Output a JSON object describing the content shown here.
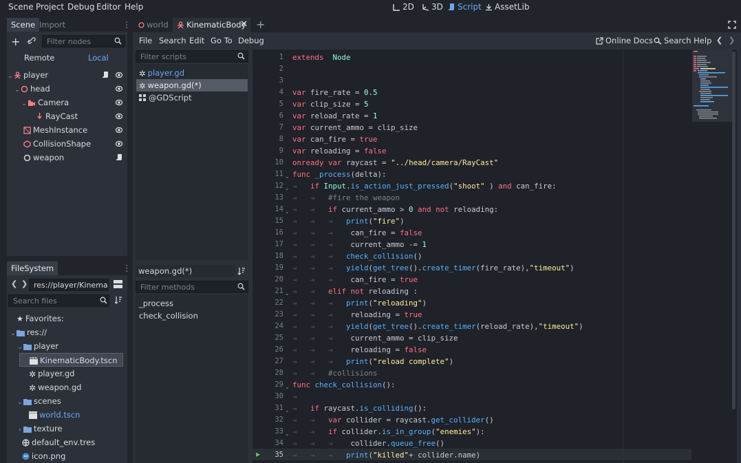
{
  "menu": [
    "Scene",
    "Project",
    "Debug",
    "Editor",
    "Help"
  ],
  "workspaces": [
    {
      "label": "2D",
      "icon": "2d-icon",
      "active": false
    },
    {
      "label": "3D",
      "icon": "3d-icon",
      "active": false
    },
    {
      "label": "Script",
      "icon": "script-icon",
      "active": true
    },
    {
      "label": "AssetLib",
      "icon": "assetlib-icon",
      "active": false
    }
  ],
  "scene_dock": {
    "tabs": [
      "Scene",
      "Import"
    ],
    "filter_placeholder": "Filter nodes",
    "remote": "Remote",
    "local": "Local",
    "nodes": [
      {
        "label": "player",
        "icon": "kinematic-body-icon"
      },
      {
        "label": "head",
        "icon": "spatial-icon"
      },
      {
        "label": "Camera",
        "icon": "camera-icon"
      },
      {
        "label": "RayCast",
        "icon": "raycast-icon"
      },
      {
        "label": "MeshInstance",
        "icon": "mesh-instance-icon"
      },
      {
        "label": "CollisionShape",
        "icon": "collision-shape-icon"
      },
      {
        "label": "weapon",
        "icon": "spatial-icon"
      }
    ]
  },
  "filesystem": {
    "tab": "FileSystem",
    "path": "res://player/Kinematic",
    "search_placeholder": "Search files",
    "items": [
      {
        "label": "Favorites:"
      },
      {
        "label": "res://"
      },
      {
        "label": "player"
      },
      {
        "label": "KinematicBody.tscn"
      },
      {
        "label": "player.gd"
      },
      {
        "label": "weapon.gd"
      },
      {
        "label": "scenes"
      },
      {
        "label": "world.tscn"
      },
      {
        "label": "texture"
      },
      {
        "label": "default_env.tres"
      },
      {
        "label": "icon.png"
      }
    ]
  },
  "scene_tabs": [
    {
      "label": "world",
      "active": false
    },
    {
      "label": "KinematicBody",
      "active": true
    }
  ],
  "script_menu": [
    "File",
    "Search",
    "Edit",
    "Go To",
    "Debug"
  ],
  "online_docs": "Online Docs",
  "search_help": "Search Help",
  "scripts_panel": {
    "filter_placeholder": "Filter scripts",
    "scripts": [
      "player.gd",
      "weapon.gd(*)",
      "@GDScript"
    ],
    "current": "weapon.gd(*)",
    "methods_placeholder": "Filter methods",
    "methods": [
      "_process",
      "check_collision"
    ]
  },
  "editor": {
    "current_line": "35",
    "line_numbers": [
      "1",
      "2",
      "3",
      "4",
      "5",
      "6",
      "7",
      "8",
      "9",
      "10",
      "11",
      "12",
      "13",
      "14",
      "15",
      "16",
      "17",
      "18",
      "19",
      "20",
      "21",
      "22",
      "23",
      "24",
      "25",
      "26",
      "27",
      "28",
      "29",
      "30",
      "31",
      "32",
      "33",
      "34",
      "35"
    ],
    "lines": [
      [
        [
          "kw",
          "extends"
        ],
        [
          "",
          "  "
        ],
        [
          "ty",
          "Node"
        ]
      ],
      [],
      [],
      [
        [
          "kw",
          "var"
        ],
        [
          "",
          " fire_rate = "
        ],
        [
          "num",
          "0.5"
        ]
      ],
      [
        [
          "kw",
          "var"
        ],
        [
          "",
          " clip_size = "
        ],
        [
          "num",
          "5"
        ]
      ],
      [
        [
          "kw",
          "var"
        ],
        [
          "",
          " reload_rate = "
        ],
        [
          "num",
          "1"
        ]
      ],
      [
        [
          "kw",
          "var"
        ],
        [
          "",
          " current_ammo = clip_size"
        ]
      ],
      [
        [
          "kw",
          "var"
        ],
        [
          "",
          " can_fire = "
        ],
        [
          "kw",
          "true"
        ]
      ],
      [
        [
          "kw",
          "var"
        ],
        [
          "",
          " reloading = "
        ],
        [
          "kw",
          "false"
        ]
      ],
      [
        [
          "kw",
          "onready"
        ],
        [
          "",
          " "
        ],
        [
          "kw",
          "var"
        ],
        [
          "",
          " raycast = "
        ],
        [
          "str",
          "\"../head/camera/RayCast\""
        ]
      ],
      [
        [
          "kw",
          "func"
        ],
        [
          "",
          " "
        ],
        [
          "fn",
          "_process"
        ],
        [
          "",
          "(delta):"
        ]
      ],
      [
        [
          "mk",
          "⇥   "
        ],
        [
          "kw",
          "if"
        ],
        [
          "",
          " "
        ],
        [
          "ty",
          "Input"
        ],
        [
          "",
          "."
        ],
        [
          "fn",
          "is_action_just_pressed"
        ],
        [
          "",
          "("
        ],
        [
          "str",
          "\"shoot\""
        ],
        [
          "",
          " ) "
        ],
        [
          "kw",
          "and"
        ],
        [
          "",
          " can_fire:"
        ]
      ],
      [
        [
          "mk",
          "⇥   ⇥   "
        ],
        [
          "cm",
          "#fire the weapon"
        ]
      ],
      [
        [
          "mk",
          "⇥   ⇥   "
        ],
        [
          "kw",
          "if"
        ],
        [
          "",
          " current_ammo > "
        ],
        [
          "num",
          "0"
        ],
        [
          "",
          " "
        ],
        [
          "kw",
          "and not"
        ],
        [
          "",
          " reloading:"
        ]
      ],
      [
        [
          "mk",
          "⇥   ⇥   ⇥   "
        ],
        [
          "fn",
          "print"
        ],
        [
          "",
          "("
        ],
        [
          "str",
          "\"fire\""
        ],
        [
          "",
          ")"
        ]
      ],
      [
        [
          "mk",
          "⇥   ⇥   ⇥   "
        ],
        [
          "",
          " can_fire = "
        ],
        [
          "kw",
          "false"
        ]
      ],
      [
        [
          "mk",
          "⇥   ⇥   ⇥   "
        ],
        [
          "",
          " current_ammo -= "
        ],
        [
          "num",
          "1"
        ]
      ],
      [
        [
          "mk",
          "⇥   ⇥   ⇥   "
        ],
        [
          "fn",
          "check_collision"
        ],
        [
          "",
          "()"
        ]
      ],
      [
        [
          "mk",
          "⇥   ⇥   ⇥   "
        ],
        [
          "fn",
          "yield"
        ],
        [
          "",
          "("
        ],
        [
          "fn",
          "get_tree"
        ],
        [
          "",
          "()."
        ],
        [
          "fn",
          "create_timer"
        ],
        [
          "",
          "(fire_rate),"
        ],
        [
          "str",
          "\"timeout\""
        ],
        [
          "",
          ")"
        ]
      ],
      [
        [
          "mk",
          "⇥   ⇥   ⇥   "
        ],
        [
          "",
          " can_fire = "
        ],
        [
          "kw",
          "true"
        ]
      ],
      [
        [
          "mk",
          "⇥   ⇥   "
        ],
        [
          "kw",
          "elif not"
        ],
        [
          "",
          " reloading :"
        ]
      ],
      [
        [
          "mk",
          "⇥   ⇥   ⇥   "
        ],
        [
          "fn",
          "print"
        ],
        [
          "",
          "("
        ],
        [
          "str",
          "\"reloading\""
        ],
        [
          "",
          ")"
        ]
      ],
      [
        [
          "mk",
          "⇥   ⇥   ⇥   "
        ],
        [
          "",
          " reloading = "
        ],
        [
          "kw",
          "true"
        ]
      ],
      [
        [
          "mk",
          "⇥   ⇥   ⇥   "
        ],
        [
          "fn",
          "yield"
        ],
        [
          "",
          "("
        ],
        [
          "fn",
          "get_tree"
        ],
        [
          "",
          "()."
        ],
        [
          "fn",
          "create_timer"
        ],
        [
          "",
          "(reload_rate),"
        ],
        [
          "str",
          "\"timeout\""
        ],
        [
          "",
          ")"
        ]
      ],
      [
        [
          "mk",
          "⇥   ⇥   ⇥   "
        ],
        [
          "",
          " current_ammo = clip_size"
        ]
      ],
      [
        [
          "mk",
          "⇥   ⇥   ⇥   "
        ],
        [
          "",
          " reloading = "
        ],
        [
          "kw",
          "false"
        ]
      ],
      [
        [
          "mk",
          "⇥   ⇥   ⇥   "
        ],
        [
          "fn",
          "print"
        ],
        [
          "",
          "("
        ],
        [
          "str",
          "\"reload complete\""
        ],
        [
          "",
          ")"
        ]
      ],
      [
        [
          "mk",
          "⇥   ⇥   "
        ],
        [
          "cm",
          "#collisions"
        ]
      ],
      [
        [
          "kw",
          "func"
        ],
        [
          "",
          " "
        ],
        [
          "fn",
          "check_collision"
        ],
        [
          "",
          "():"
        ]
      ],
      [
        [
          "mk",
          "⇥   "
        ]
      ],
      [
        [
          "mk",
          "⇥   "
        ],
        [
          "kw",
          "if"
        ],
        [
          "",
          " raycast."
        ],
        [
          "fn",
          "is_colliding"
        ],
        [
          "",
          "():"
        ]
      ],
      [
        [
          "mk",
          "⇥   ⇥   "
        ],
        [
          "kw",
          "var"
        ],
        [
          "",
          " collider = raycast."
        ],
        [
          "fn",
          "get_collider"
        ],
        [
          "",
          "()"
        ]
      ],
      [
        [
          "mk",
          "⇥   ⇥   "
        ],
        [
          "kw",
          "if"
        ],
        [
          "",
          " collider."
        ],
        [
          "fn",
          "is_in_group"
        ],
        [
          "",
          "("
        ],
        [
          "str",
          "\"enemies\""
        ],
        [
          "",
          "):"
        ]
      ],
      [
        [
          "mk",
          "⇥   ⇥   ⇥   "
        ],
        [
          "",
          " collider."
        ],
        [
          "fn",
          "queue_free"
        ],
        [
          "",
          "()"
        ]
      ],
      [
        [
          "mk",
          "⇥   ⇥   ⇥   "
        ],
        [
          "fn",
          "print"
        ],
        [
          "",
          "("
        ],
        [
          "str",
          "\"killed\""
        ],
        [
          "",
          "+ collider.name)"
        ]
      ]
    ]
  }
}
